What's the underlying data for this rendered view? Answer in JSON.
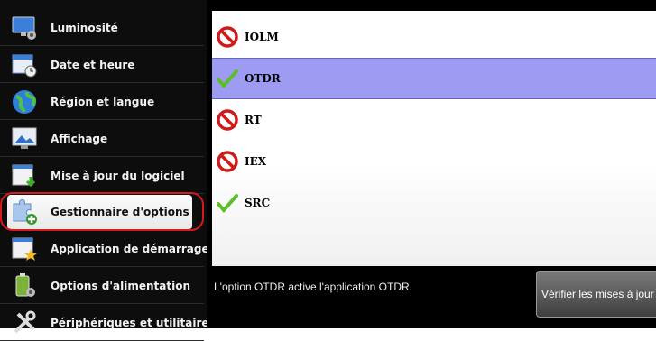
{
  "sidebar": {
    "items": [
      {
        "label": "Luminosité",
        "icon": "monitor-brightness-icon"
      },
      {
        "label": "Date et heure",
        "icon": "calendar-clock-icon"
      },
      {
        "label": "Région et langue",
        "icon": "globe-icon"
      },
      {
        "label": "Affichage",
        "icon": "display-icon"
      },
      {
        "label": "Mise à jour du logiciel",
        "icon": "software-update-icon"
      },
      {
        "label": "Gestionnaire d'options",
        "icon": "puzzle-plus-icon"
      },
      {
        "label": "Application de démarrage",
        "icon": "startup-app-icon"
      },
      {
        "label": "Options d'alimentation",
        "icon": "battery-icon"
      },
      {
        "label": "Périphériques et utilitaires",
        "icon": "tools-icon"
      }
    ],
    "selected_index": 5
  },
  "options": {
    "items": [
      {
        "name": "IOLM",
        "status": "disabled"
      },
      {
        "name": "OTDR",
        "status": "enabled"
      },
      {
        "name": "RT",
        "status": "disabled"
      },
      {
        "name": "IEX",
        "status": "disabled"
      },
      {
        "name": "SRC",
        "status": "enabled"
      }
    ],
    "selected": "OTDR"
  },
  "description": "L'option OTDR active l'application OTDR.",
  "update_button_label": "Vérifier les mises à jour",
  "colors": {
    "selection_row": "#9d9cf2",
    "highlight_ring": "#d71920",
    "sidebar_bg": "#0d0d0d",
    "disabled_icon": "#d01a1a",
    "enabled_icon": "#5cbf2a"
  }
}
